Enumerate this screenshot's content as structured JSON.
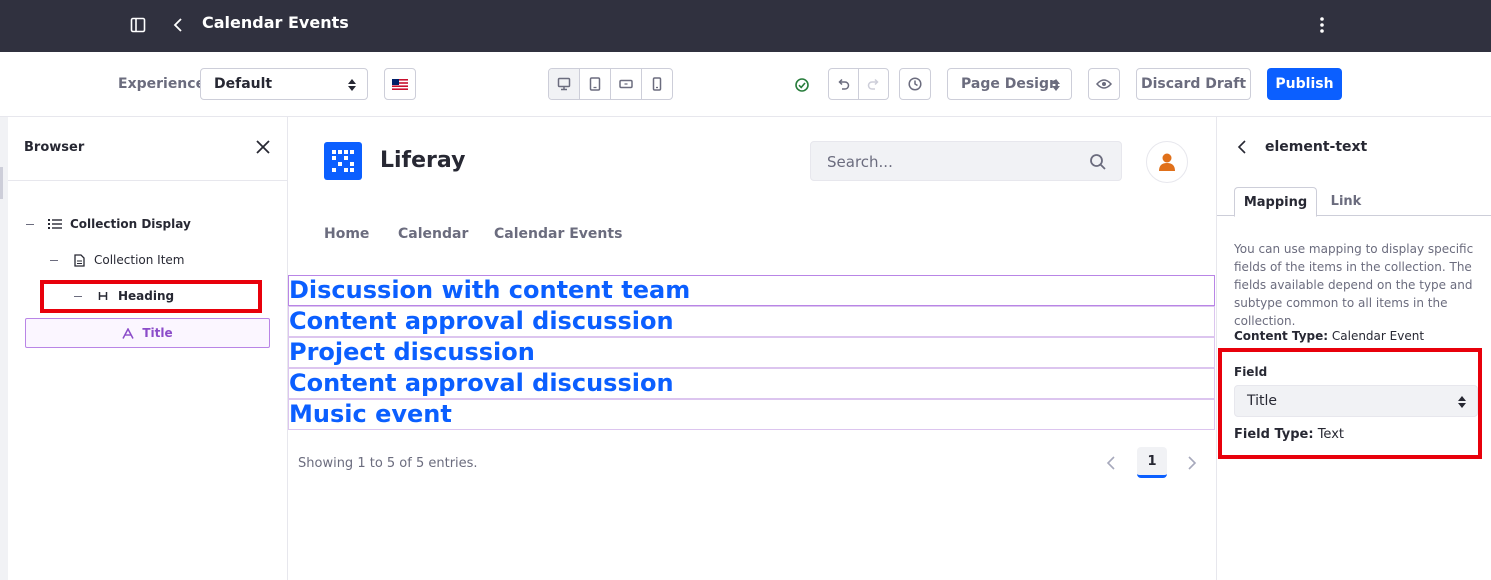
{
  "topbar": {
    "title": "Calendar Events",
    "icons": [
      "sidebar-toggle-icon",
      "back-icon",
      "kebab-menu-icon"
    ]
  },
  "toolbar": {
    "experience_label": "Experience",
    "experience_value": "Default",
    "locale_icon": "us-flag-icon",
    "devices": [
      "desktop-icon",
      "tablet-icon",
      "landscape-phone-icon",
      "portrait-phone-icon"
    ],
    "active_device": "desktop",
    "page_design_label": "Page Design",
    "discard_label": "Discard Draft",
    "publish_label": "Publish"
  },
  "browser": {
    "title": "Browser",
    "tree": [
      {
        "label": "Collection Display",
        "icon": "list-icon",
        "level": 0
      },
      {
        "label": "Collection Item",
        "icon": "document-icon",
        "level": 1
      },
      {
        "label": "Heading",
        "icon": "heading-icon",
        "level": 2
      }
    ],
    "selected_item": "Title",
    "selected_icon": "text-icon"
  },
  "site": {
    "brand": "Liferay",
    "search_placeholder": "Search...",
    "nav": [
      "Home",
      "Calendar",
      "Calendar Events"
    ],
    "headings": [
      "Discussion with content team",
      "Content approval discussion",
      "Project discussion",
      "Content approval discussion",
      "Music event"
    ],
    "showing": "Showing 1 to 5 of 5 entries.",
    "current_page": "1"
  },
  "panel": {
    "title": "element-text",
    "tabs": [
      "Mapping",
      "Link"
    ],
    "active_tab": "Mapping",
    "description": "You can use mapping to display specific fields of the items in the collection. The fields available depend on the type and subtype common to all items in the collection.",
    "content_type_label": "Content Type:",
    "content_type_value": "Calendar Event",
    "field_label": "Field",
    "field_value": "Title",
    "field_type_label": "Field Type:",
    "field_type_value": "Text"
  },
  "colors": {
    "topbar": "#30313f",
    "primary": "#0b5fff",
    "highlight": "#e8000b",
    "selection": "#b985e6"
  }
}
